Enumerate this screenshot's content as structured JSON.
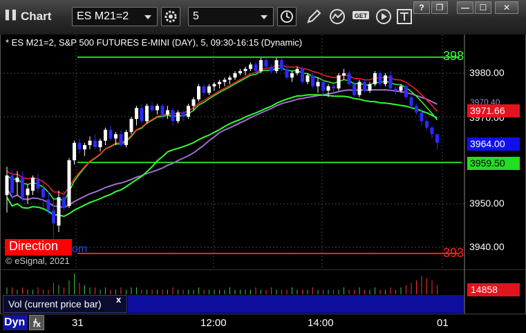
{
  "window": {
    "title": "Chart",
    "grip": "▌▌",
    "controls": {
      "help": "?",
      "restore": "❐",
      "minimize": "—",
      "maximize": "☐",
      "close": "✕"
    }
  },
  "toolbar": {
    "symbol_value": "ES M21=2",
    "interval_value": "5",
    "get_label": "GET"
  },
  "chart_title": "* ES M21=2, S&P 500 FUTURES E-MINI (DAY), 5, 09:30-16:15 (Dynamic)",
  "watermark": "© eSignal, 2021",
  "direction": {
    "label": "Direction",
    "tail": "om"
  },
  "edge_labels": {
    "upper": "398",
    "lower": "393"
  },
  "price_tags": {
    "red": "3971.66",
    "last": "3964.00",
    "green": "3959.50",
    "partial": "3970.40"
  },
  "volume": {
    "legend": "Vol (current price bar)",
    "close": "x",
    "last_value": "14858"
  },
  "bottom": {
    "dyn_label": "Dyn"
  },
  "colors": {
    "up": "#ffffff",
    "down": "#2a2aff",
    "green_line": "#33ff33",
    "red_line": "#ff2020",
    "purple_line": "#a070d0",
    "level_green": "#22dd22",
    "level_red": "#ff2020"
  },
  "chart_data": {
    "type": "candlestick",
    "ylim": [
      3936,
      3988
    ],
    "y_ticks": [
      "3980.00",
      "3970.00",
      "3950.00",
      "3940.00"
    ],
    "x_ticks": [
      "31",
      "12:00",
      "14:00",
      "01"
    ],
    "levels": {
      "upper_green": 3983.7,
      "lower_green": 3959.5,
      "lower_red": 3938.6
    },
    "candles": [
      [
        3952.0,
        3958.5,
        3948.0,
        3956.5
      ],
      [
        3956.5,
        3958.0,
        3951.0,
        3952.5
      ],
      [
        3955.0,
        3957.5,
        3952.0,
        3956.0
      ],
      [
        3956.0,
        3957.5,
        3950.5,
        3951.5
      ],
      [
        3952.0,
        3954.5,
        3950.0,
        3953.5
      ],
      [
        3953.0,
        3956.5,
        3952.0,
        3956.0
      ],
      [
        3955.5,
        3957.0,
        3952.5,
        3953.5
      ],
      [
        3953.5,
        3955.5,
        3949.0,
        3951.5
      ],
      [
        3951.0,
        3953.0,
        3947.5,
        3948.5
      ],
      [
        3948.5,
        3951.0,
        3941.0,
        3945.5
      ],
      [
        3945.0,
        3953.0,
        3943.5,
        3951.5
      ],
      [
        3951.5,
        3953.0,
        3948.5,
        3949.0
      ],
      [
        3949.5,
        3960.5,
        3949.0,
        3960.0
      ],
      [
        3960.0,
        3964.5,
        3959.0,
        3964.0
      ],
      [
        3964.0,
        3965.0,
        3961.5,
        3962.5
      ],
      [
        3962.5,
        3964.0,
        3961.0,
        3963.5
      ],
      [
        3963.5,
        3965.5,
        3962.5,
        3964.5
      ],
      [
        3964.5,
        3966.0,
        3962.5,
        3963.0
      ],
      [
        3963.0,
        3965.0,
        3962.0,
        3964.5
      ],
      [
        3964.5,
        3967.5,
        3963.5,
        3967.0
      ],
      [
        3967.0,
        3968.0,
        3964.5,
        3965.0
      ],
      [
        3965.0,
        3966.5,
        3963.5,
        3966.0
      ],
      [
        3966.0,
        3967.0,
        3963.0,
        3963.5
      ],
      [
        3963.5,
        3967.0,
        3963.0,
        3966.5
      ],
      [
        3966.5,
        3970.0,
        3966.0,
        3969.5
      ],
      [
        3969.5,
        3972.5,
        3968.0,
        3972.0
      ],
      [
        3972.0,
        3973.0,
        3968.5,
        3969.0
      ],
      [
        3969.0,
        3973.0,
        3968.5,
        3972.5
      ],
      [
        3972.5,
        3973.5,
        3971.0,
        3971.5
      ],
      [
        3971.5,
        3973.0,
        3970.5,
        3972.5
      ],
      [
        3972.5,
        3973.0,
        3969.5,
        3970.5
      ],
      [
        3970.5,
        3972.5,
        3969.5,
        3971.5
      ],
      [
        3971.5,
        3972.0,
        3968.0,
        3969.0
      ],
      [
        3969.0,
        3971.5,
        3968.5,
        3971.0
      ],
      [
        3971.0,
        3971.5,
        3969.0,
        3970.0
      ],
      [
        3970.0,
        3973.0,
        3969.5,
        3972.5
      ],
      [
        3972.5,
        3974.5,
        3971.5,
        3974.0
      ],
      [
        3974.0,
        3977.5,
        3973.5,
        3977.0
      ],
      [
        3977.0,
        3977.5,
        3975.0,
        3975.5
      ],
      [
        3975.5,
        3977.5,
        3975.0,
        3977.0
      ],
      [
        3977.0,
        3978.0,
        3976.0,
        3977.5
      ],
      [
        3977.5,
        3978.5,
        3976.5,
        3978.0
      ],
      [
        3978.0,
        3979.0,
        3977.0,
        3978.5
      ],
      [
        3978.5,
        3979.5,
        3977.5,
        3979.0
      ],
      [
        3979.0,
        3980.5,
        3978.5,
        3980.0
      ],
      [
        3980.0,
        3981.0,
        3979.5,
        3980.5
      ],
      [
        3980.5,
        3981.5,
        3979.5,
        3981.0
      ],
      [
        3981.0,
        3982.5,
        3980.5,
        3982.0
      ],
      [
        3982.0,
        3982.5,
        3980.0,
        3980.5
      ],
      [
        3980.5,
        3983.5,
        3980.0,
        3983.0
      ],
      [
        3983.0,
        3983.5,
        3981.0,
        3981.5
      ],
      [
        3981.5,
        3982.0,
        3980.0,
        3980.5
      ],
      [
        3980.5,
        3983.5,
        3980.0,
        3983.0
      ],
      [
        3983.0,
        3983.5,
        3980.5,
        3981.0
      ],
      [
        3981.0,
        3982.0,
        3978.5,
        3979.0
      ],
      [
        3979.0,
        3980.5,
        3978.0,
        3980.0
      ],
      [
        3980.0,
        3981.5,
        3979.5,
        3981.0
      ],
      [
        3981.0,
        3981.5,
        3977.5,
        3978.0
      ],
      [
        3978.0,
        3980.0,
        3977.5,
        3979.5
      ],
      [
        3979.5,
        3980.0,
        3976.5,
        3977.0
      ],
      [
        3977.0,
        3979.0,
        3975.5,
        3978.0
      ],
      [
        3978.0,
        3978.5,
        3975.0,
        3976.0
      ],
      [
        3976.0,
        3977.5,
        3974.5,
        3977.0
      ],
      [
        3977.0,
        3977.5,
        3975.5,
        3976.5
      ],
      [
        3976.5,
        3980.0,
        3976.0,
        3979.5
      ],
      [
        3979.5,
        3981.0,
        3978.5,
        3980.0
      ],
      [
        3980.0,
        3980.5,
        3977.0,
        3977.5
      ],
      [
        3977.5,
        3978.0,
        3974.5,
        3975.0
      ],
      [
        3975.0,
        3978.5,
        3974.5,
        3978.0
      ],
      [
        3978.0,
        3978.5,
        3975.5,
        3976.0
      ],
      [
        3976.0,
        3978.0,
        3975.5,
        3977.5
      ],
      [
        3977.5,
        3980.5,
        3977.0,
        3980.0
      ],
      [
        3980.0,
        3980.5,
        3977.0,
        3977.5
      ],
      [
        3977.5,
        3980.0,
        3977.0,
        3979.5
      ],
      [
        3979.5,
        3980.5,
        3976.0,
        3976.5
      ],
      [
        3976.5,
        3977.0,
        3975.0,
        3976.0
      ],
      [
        3976.0,
        3977.5,
        3975.5,
        3977.0
      ],
      [
        3977.0,
        3977.5,
        3974.0,
        3974.5
      ],
      [
        3974.5,
        3975.0,
        3971.5,
        3972.5
      ],
      [
        3972.5,
        3973.0,
        3970.5,
        3971.0
      ],
      [
        3971.0,
        3972.0,
        3968.0,
        3969.0
      ],
      [
        3969.0,
        3969.5,
        3967.0,
        3967.5
      ],
      [
        3967.5,
        3968.0,
        3965.0,
        3966.0
      ],
      [
        3966.0,
        3966.0,
        3962.5,
        3964.0
      ]
    ],
    "volume": [
      3,
      3,
      2,
      3,
      2,
      2,
      3,
      2,
      2,
      5,
      4,
      3,
      6,
      9,
      5,
      4,
      3,
      3,
      2,
      3,
      2,
      2,
      3,
      2,
      3,
      3,
      2,
      2,
      2,
      2,
      2,
      2,
      3,
      2,
      2,
      2,
      2,
      3,
      2,
      2,
      2,
      2,
      2,
      3,
      2,
      2,
      2,
      2,
      3,
      2,
      2,
      3,
      2,
      2,
      2,
      3,
      2,
      2,
      2,
      3,
      2,
      2,
      2,
      2,
      2,
      3,
      2,
      2,
      3,
      2,
      2,
      3,
      2,
      2,
      3,
      2,
      3,
      4,
      5,
      6,
      8,
      7,
      6,
      4
    ]
  }
}
